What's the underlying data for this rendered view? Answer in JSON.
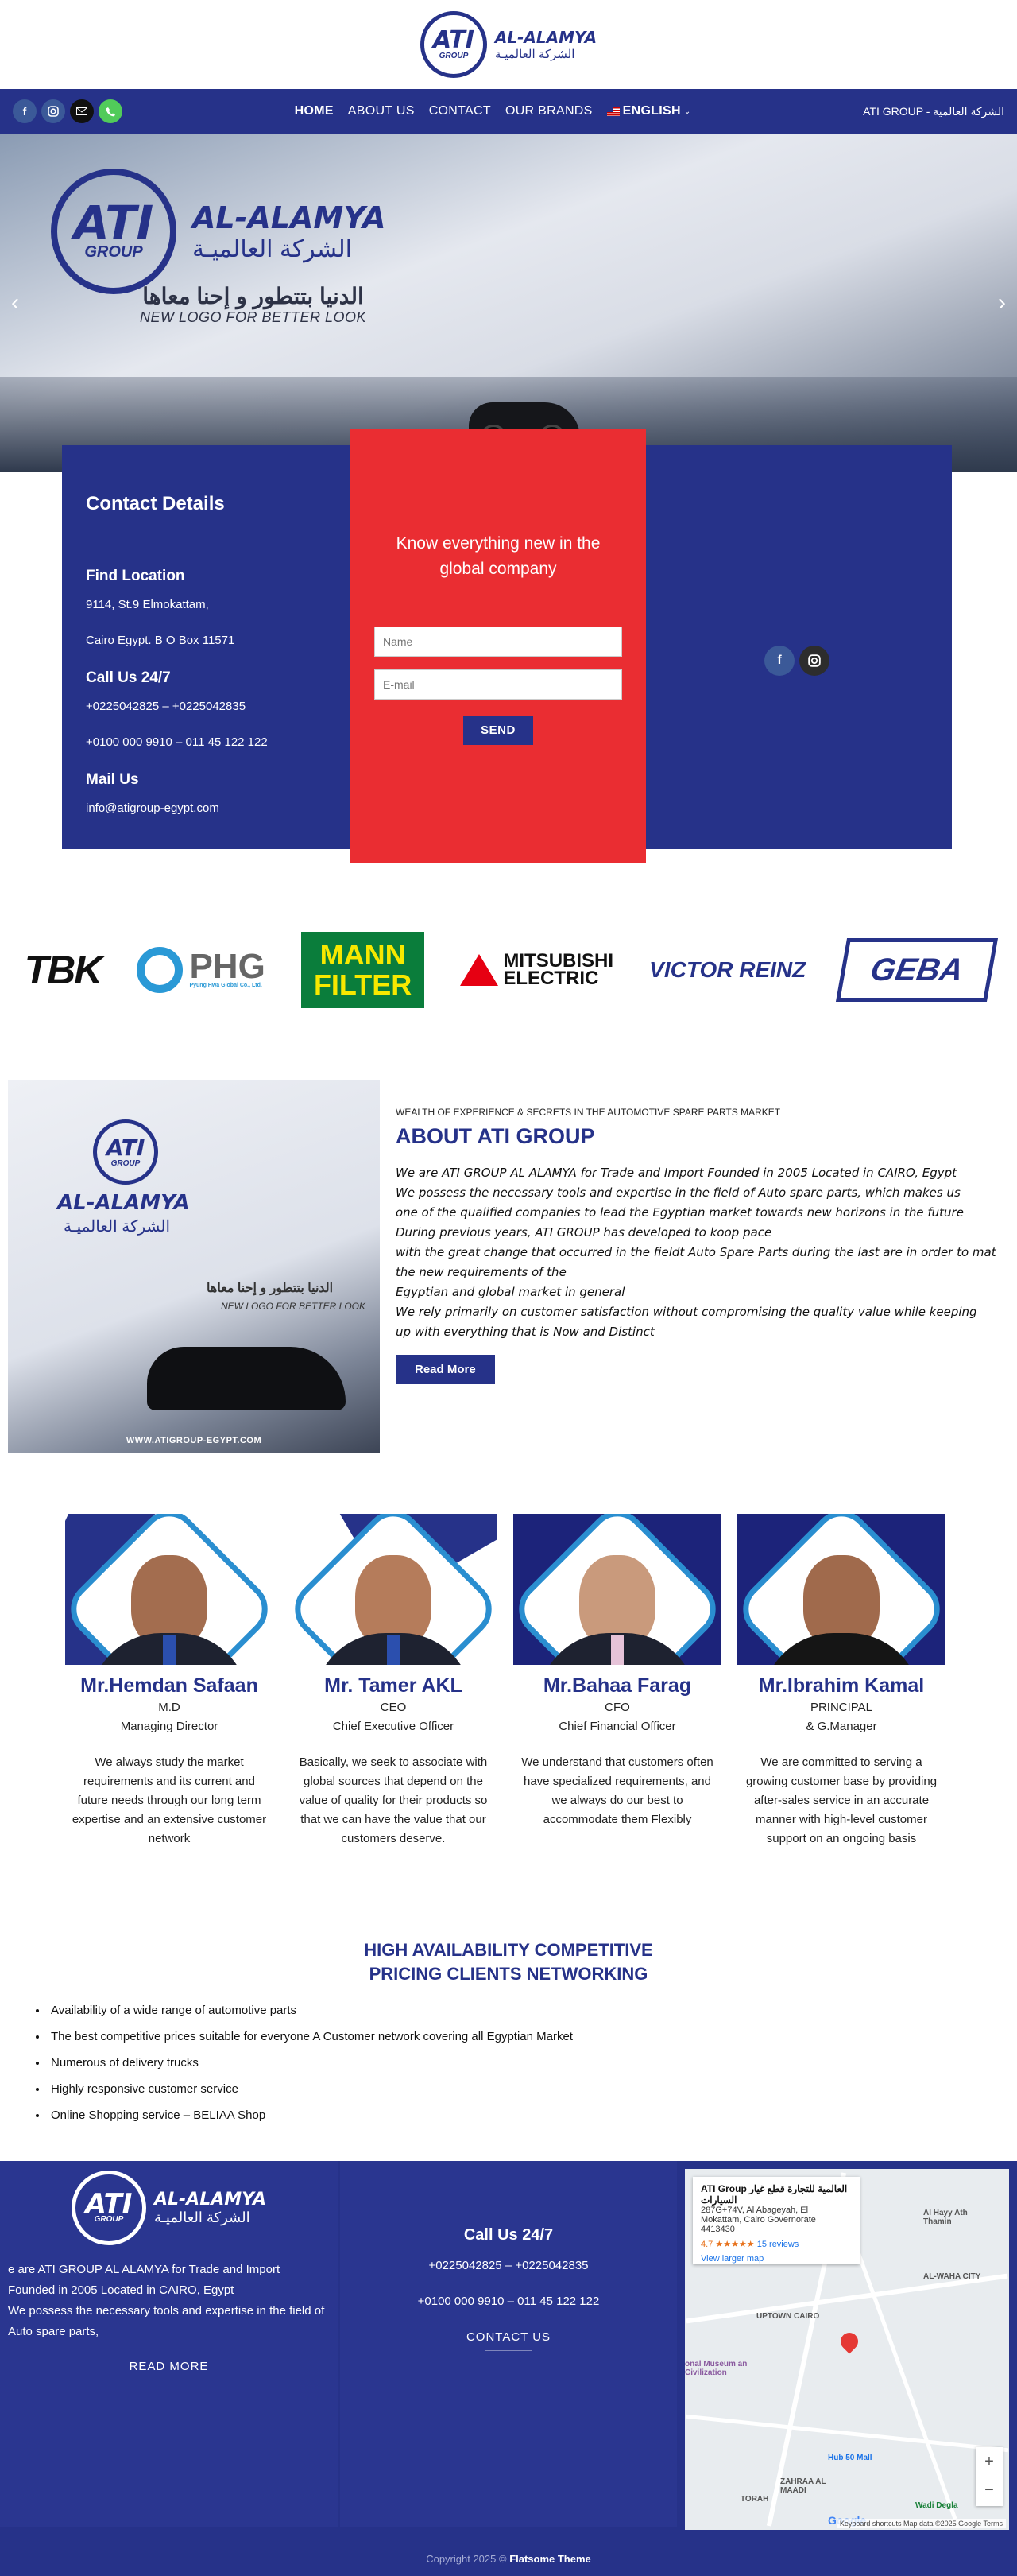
{
  "header": {
    "logo_mark": "ATI",
    "logo_group": "GROUP",
    "logo_en": "AL-ALAMYA",
    "logo_ar": "الشركة العالميـة"
  },
  "nav": {
    "items": [
      "HOME",
      "ABOUT US",
      "CONTACT",
      "OUR BRANDS"
    ],
    "language": "ENGLISH",
    "brand_right": "ATI GROUP - الشركة العالمية",
    "social_icons": [
      "facebook-icon",
      "instagram-icon",
      "mail-icon",
      "phone-icon"
    ]
  },
  "hero": {
    "logo_mark": "ATI",
    "logo_group": "GROUP",
    "logo_en": "AL-ALAMYA",
    "logo_ar": "الشركة العالميـة",
    "slogan_ar": "الدنيا بتتطور و إحنا معاها",
    "slogan_en": "NEW LOGO FOR BETTER LOOK",
    "prev": "‹",
    "next": "›"
  },
  "contact": {
    "title": "Contact Details",
    "location_title": "Find Location",
    "address_1": "9114, St.9 Elmokattam,",
    "address_2": "Cairo Egypt. B O Box 11571",
    "call_title": "Call Us 24/7",
    "phone_1": "+0225042825 – +0225042835",
    "phone_2": "+0100 000 9910 – 011 45 122 122",
    "mail_title": "Mail Us",
    "email": "info@atigroup-egypt.com"
  },
  "newsletter": {
    "tagline": "Know everything new in the global company",
    "name_placeholder": "Name",
    "email_placeholder": "E-mail",
    "send_label": "SEND"
  },
  "brands": {
    "tbk": "TBK",
    "phg": "PHG",
    "phg_sub": "Pyung Hwa Global Co., Ltd.",
    "mann_1": "MANN",
    "mann_2": "FILTER",
    "mitsubishi_1": "MITSUBISHI",
    "mitsubishi_2": "ELECTRIC",
    "victor": "VICTOR REINZ",
    "geba": "GEBA"
  },
  "about": {
    "image_logo_mark": "ATI",
    "image_logo_group": "GROUP",
    "image_logo_en": "AL-ALAMYA",
    "image_logo_ar": "الشركة العالميـة",
    "image_slogan_ar": "الدنيا بتتطور و إحنا معاها",
    "image_slogan_en": "NEW LOGO FOR BETTER LOOK",
    "image_url_text": "WWW.ATIGROUP-EGYPT.COM",
    "kicker": "WEALTH OF EXPERIENCE & SECRETS IN THE AUTOMOTIVE SPARE PARTS MARKET",
    "title": "ABOUT ATI GROUP",
    "lines": [
      "We are ATI GROUP AL ALAMYA for Trade and Import Founded in 2005 Located in CAIRO, Egypt",
      "We possess the necessary tools and expertise in the field of Auto spare parts, which makes us",
      "one of the qualified companies to lead the Egyptian market towards new horizons in the future",
      "During previous years, ATI GROUP has developed to koop pace",
      "with the great change that occurred in the fieldt Auto Spare Parts during the last are in order to mat",
      "the new requirements of the",
      "Egyptian and global market in general",
      "We rely primarily on customer satisfaction without compromising the quality value while keeping",
      "up with everything that is Now and Distinct"
    ],
    "read_more": "Read More"
  },
  "team": [
    {
      "name": "Mr.Hemdan Safaan",
      "role": "M.D",
      "title": "Managing Director",
      "desc": "We always study the market requirements and its current and future needs through our long term expertise and an extensive customer network"
    },
    {
      "name": "Mr. Tamer AKL",
      "role": "CEO",
      "title": "Chief Executive Officer",
      "desc": "Basically, we seek to associate with global sources that depend on the value of quality for their products so that we can have the value that our customers deserve."
    },
    {
      "name": "Mr.Bahaa Farag",
      "role": "CFO",
      "title": "Chief Financial Officer",
      "desc": "We understand that customers often have specialized requirements, and we always do our best to accommodate them Flexibly"
    },
    {
      "name": "Mr.Ibrahim Kamal",
      "role": "PRINCIPAL",
      "title": "& G.Manager",
      "desc": "We are committed to serving a growing customer base by providing after-sales service in an accurate manner with high-level customer support on an ongoing basis"
    }
  ],
  "highlights": {
    "line1": "HIGH AVAILABILITY COMPETITIVE",
    "line2": "PRICING CLIENTS NETWORKING",
    "features": [
      "Availability of a wide range of automotive parts",
      "The best competitive prices suitable for everyone A Customer network covering all Egyptian Market",
      "Numerous of delivery trucks",
      "Highly responsive customer service",
      "Online Shopping service – BELIAA Shop"
    ]
  },
  "footer": {
    "logo_mark": "ATI",
    "logo_group": "GROUP",
    "logo_en": "AL-ALAMYA",
    "logo_ar": "الشركة العالميـة",
    "about_1": "e are ATI GROUP AL ALAMYA for Trade and Import",
    "about_2": "Founded in 2005 Located in CAIRO, Egypt",
    "about_3": "We possess the necessary tools and expertise in the field of",
    "about_4": "Auto spare parts,",
    "read_more": "READ MORE",
    "call_title": "Call Us 24/7",
    "phone_1": "+0225042825 – +0225042835",
    "phone_2": "+0100 000 9910 – 011 45 122 122",
    "contact_us": "CONTACT US",
    "map_card_title": "ATI Group العالمية للتجارة قطع غيار السيارات",
    "map_card_address_1": "287G+74V, Al Abageyah, El",
    "map_card_address_2": "Mokattam, Cairo Governorate",
    "map_card_address_3": "4413430",
    "map_rating": "4.7",
    "map_stars": "★★★★★",
    "map_reviews": "15 reviews",
    "map_larger": "View larger map",
    "map_label_1": "Al Hayy Ath Thamin",
    "map_label_2": "UPTOWN CAIRO",
    "map_label_3": "onal Museum an Civilization",
    "map_label_4": "Hub 50 Mall",
    "map_label_5": "TORAH",
    "map_label_6": "ZAHRAA AL MAADI",
    "map_label_7": "Wadi Degla",
    "map_label_8": "AL-WAHA CITY",
    "map_zoom_in": "+",
    "map_zoom_out": "−",
    "map_google": "Google",
    "map_attribution": "Keyboard shortcuts   Map data ©2025 Google   Terms",
    "copyright_prefix": "Copyright 2025 ©",
    "copyright_brand": "Flatsome Theme"
  }
}
